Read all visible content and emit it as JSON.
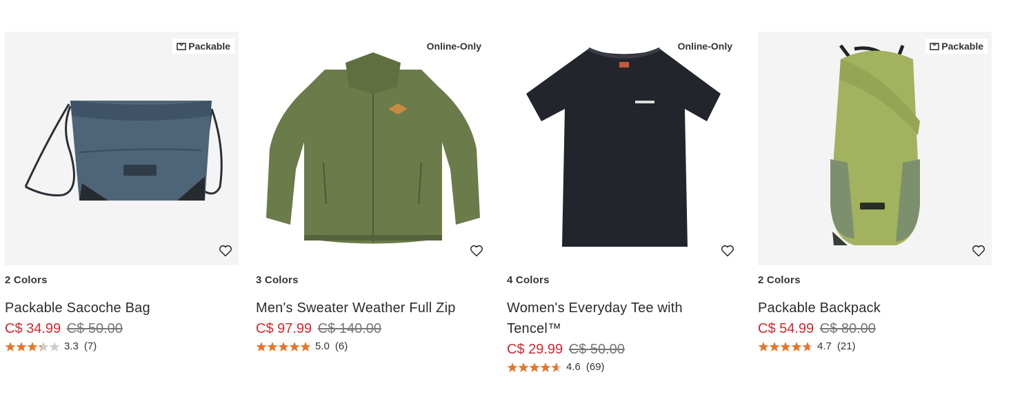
{
  "colors": {
    "sale": "#d3272e",
    "star": "#e5762a",
    "star_empty": "#cccccc"
  },
  "products": [
    {
      "badge": "Packable",
      "badge_icon": "packable-icon",
      "color_count": "2 Colors",
      "name": "Packable Sacoche Bag",
      "sale_price": "C$ 34.99",
      "original_price": "C$ 50.00",
      "rating": 3.3,
      "rating_text": "3.3",
      "reviews": "(7)"
    },
    {
      "badge": "Online-Only",
      "color_count": "3 Colors",
      "name": "Men's Sweater Weather Full Zip",
      "sale_price": "C$ 97.99",
      "original_price": "C$ 140.00",
      "rating": 5.0,
      "rating_text": "5.0",
      "reviews": "(6)"
    },
    {
      "badge": "Online-Only",
      "color_count": "4 Colors",
      "name": "Women's Everyday Tee with Tencel™",
      "sale_price": "C$ 29.99",
      "original_price": "C$ 50.00",
      "rating": 4.6,
      "rating_text": "4.6",
      "reviews": "(69)"
    },
    {
      "badge": "Packable",
      "badge_icon": "packable-icon",
      "color_count": "2 Colors",
      "name": "Packable Backpack",
      "sale_price": "C$ 54.99",
      "original_price": "C$ 80.00",
      "rating": 4.7,
      "rating_text": "4.7",
      "reviews": "(21)"
    }
  ]
}
